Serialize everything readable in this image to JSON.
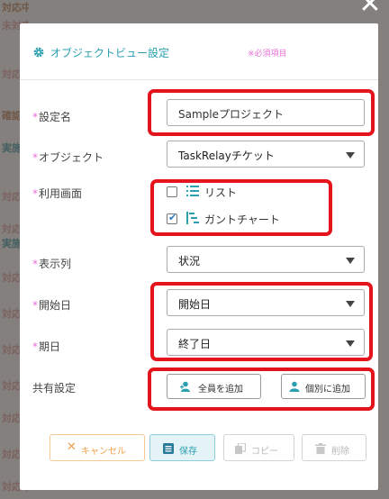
{
  "background_items": [
    {
      "label": "対応中",
      "tone": "brown"
    },
    {
      "label": "未対応",
      "tone": "pink"
    },
    {
      "label": "対応中",
      "tone": "pink"
    },
    {
      "label": "確認中",
      "tone": "brown"
    },
    {
      "label": "実施中",
      "tone": "green"
    },
    {
      "label": "対応中",
      "tone": "pink"
    },
    {
      "label": "対応中",
      "tone": "pink"
    },
    {
      "label": "実施中",
      "tone": "green"
    },
    {
      "label": "対応中",
      "tone": "pink"
    },
    {
      "label": "対応中",
      "tone": "pink"
    },
    {
      "label": "対応中",
      "tone": "pink"
    },
    {
      "label": "対応中",
      "tone": "pink"
    },
    {
      "label": "対応中",
      "tone": "pink"
    },
    {
      "label": "対応中",
      "tone": "pink"
    },
    {
      "label": "対応中",
      "tone": "pink"
    }
  ],
  "close_glyph": "✕",
  "dialog": {
    "title": "オブジェクトビュー設定",
    "required_note": "※必須項目",
    "fields": {
      "setting_name": {
        "label": "設定名",
        "value": "Sampleプロジェクト"
      },
      "object": {
        "label": "オブジェクト",
        "value": "TaskRelayチケット"
      },
      "usage_screen": {
        "label": "利用画面",
        "options": [
          {
            "label": "リスト",
            "checked": false,
            "icon": "list-icon"
          },
          {
            "label": "ガントチャート",
            "checked": true,
            "icon": "gantt-icon"
          }
        ]
      },
      "display_column": {
        "label": "表示列",
        "value": "状況"
      },
      "start_date": {
        "label": "開始日",
        "value": "開始日"
      },
      "due_date": {
        "label": "期日",
        "value": "終了日"
      },
      "sharing": {
        "label": "共有設定",
        "add_all": "全員を追加",
        "add_individual": "個別に追加"
      }
    },
    "buttons": {
      "cancel": "キャンセル",
      "save": "保存",
      "copy": "コピー",
      "delete": "削除"
    },
    "required_mark": "*",
    "check_mark": "✔"
  },
  "colors": {
    "accent": "#2a9fb0",
    "required": "#e86fd8",
    "highlight": "#e4141c",
    "cancel": "#f0a050",
    "save": "#2a9fb0"
  }
}
